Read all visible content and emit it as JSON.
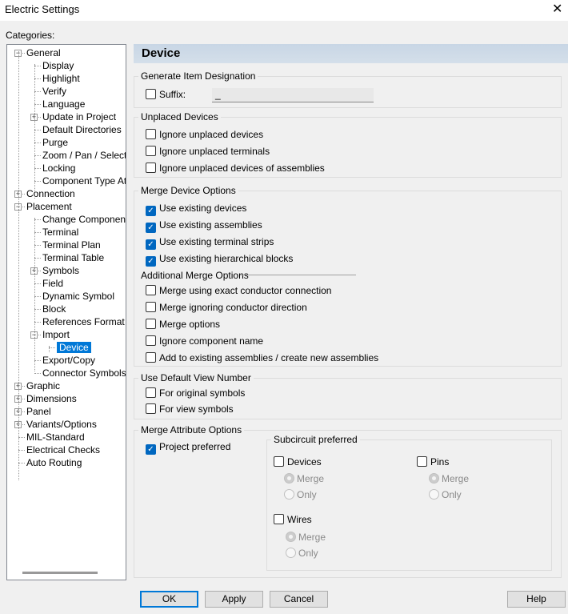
{
  "window": {
    "title": "Electric Settings",
    "close": "✕"
  },
  "categories_label": "Categories:",
  "tree": [
    {
      "label": "General",
      "level": 0,
      "expander": "-"
    },
    {
      "label": "Display",
      "level": 1
    },
    {
      "label": "Highlight",
      "level": 1
    },
    {
      "label": "Verify",
      "level": 1
    },
    {
      "label": "Language",
      "level": 1
    },
    {
      "label": "Update in Project",
      "level": 1,
      "expander": "+"
    },
    {
      "label": "Default Directories",
      "level": 1
    },
    {
      "label": "Purge",
      "level": 1
    },
    {
      "label": "Zoom / Pan / Selectio",
      "level": 1
    },
    {
      "label": "Locking",
      "level": 1
    },
    {
      "label": "Component Type Attri",
      "level": 1
    },
    {
      "label": "Connection",
      "level": 0,
      "expander": "+"
    },
    {
      "label": "Placement",
      "level": 0,
      "expander": "-"
    },
    {
      "label": "Change Component",
      "level": 1
    },
    {
      "label": "Terminal",
      "level": 1
    },
    {
      "label": "Terminal Plan",
      "level": 1
    },
    {
      "label": "Terminal Table",
      "level": 1
    },
    {
      "label": "Symbols",
      "level": 1,
      "expander": "+"
    },
    {
      "label": "Field",
      "level": 1
    },
    {
      "label": "Dynamic Symbol",
      "level": 1
    },
    {
      "label": "Block",
      "level": 1
    },
    {
      "label": "References Format",
      "level": 1
    },
    {
      "label": "Import",
      "level": 1,
      "expander": "-"
    },
    {
      "label": "Device",
      "level": 2,
      "selected": true
    },
    {
      "label": "Export/Copy",
      "level": 1
    },
    {
      "label": "Connector Symbols",
      "level": 1
    },
    {
      "label": "Graphic",
      "level": 0,
      "expander": "+"
    },
    {
      "label": "Dimensions",
      "level": 0,
      "expander": "+"
    },
    {
      "label": "Panel",
      "level": 0,
      "expander": "+"
    },
    {
      "label": "Variants/Options",
      "level": 0,
      "expander": "+"
    },
    {
      "label": "MIL-Standard",
      "level": 0
    },
    {
      "label": "Electrical Checks",
      "level": 0
    },
    {
      "label": "Auto Routing",
      "level": 0
    }
  ],
  "panel": {
    "header": "Device",
    "gen": {
      "title": "Generate Item Designation",
      "suffix_label": "Suffix:",
      "suffix_checked": false,
      "suffix_value": "_"
    },
    "unplaced": {
      "title": "Unplaced Devices",
      "items": [
        {
          "label": "Ignore unplaced devices",
          "checked": false
        },
        {
          "label": "Ignore unplaced terminals",
          "checked": false
        },
        {
          "label": "Ignore unplaced devices of assemblies",
          "checked": false
        }
      ]
    },
    "merge": {
      "title": "Merge Device Options",
      "items": [
        {
          "label": "Use existing devices",
          "checked": true
        },
        {
          "label": "Use existing assemblies",
          "checked": true
        },
        {
          "label": "Use existing terminal strips",
          "checked": true
        },
        {
          "label": "Use existing hierarchical blocks",
          "checked": true
        }
      ],
      "additional_title": "Additional Merge Options",
      "additional": [
        {
          "label": "Merge using exact conductor connection",
          "checked": false
        },
        {
          "label": "Merge ignoring conductor direction",
          "checked": false
        },
        {
          "label": "Merge options",
          "checked": false
        },
        {
          "label": "Ignore component name",
          "checked": false
        },
        {
          "label": "Add to existing assemblies / create new assemblies",
          "checked": false
        }
      ]
    },
    "view": {
      "title": "Use Default View Number",
      "items": [
        {
          "label": "For original symbols",
          "checked": false
        },
        {
          "label": "For view symbols",
          "checked": false
        }
      ]
    },
    "attr": {
      "title": "Merge Attribute Options",
      "project_preferred": "Project preferred",
      "project_checked": true,
      "sub_title": "Subcircuit preferred",
      "devices": "Devices",
      "pins": "Pins",
      "wires": "Wires",
      "merge": "Merge",
      "only": "Only"
    }
  },
  "buttons": {
    "ok": "OK",
    "apply": "Apply",
    "cancel": "Cancel",
    "help": "Help"
  }
}
